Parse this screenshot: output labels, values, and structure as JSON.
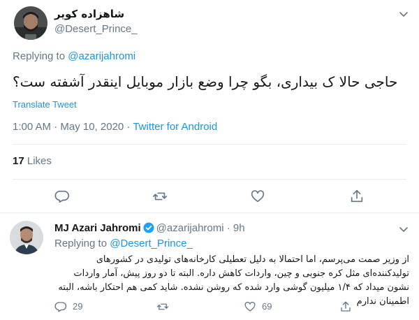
{
  "tweet": {
    "author_name": "شاهزاده کویر",
    "author_handle": "@Desert_Prince_",
    "replying_prefix": "Replying to ",
    "replying_to": "@azarijahromi",
    "text": "حاجی حالا ک بیداری، بگو چرا وضع بازار موبایل اینقدر آشفته ست؟",
    "translate_label": "Translate Tweet",
    "timestamp": "1:00 AM · May 10, 2020 · ",
    "source": "Twitter for Android",
    "likes_count": "17",
    "likes_label": " Likes",
    "icons": [
      "reply-icon",
      "retweet-icon",
      "like-icon",
      "share-icon",
      "chevron-down-icon"
    ]
  },
  "reply": {
    "author_name": "MJ Azari Jahromi",
    "author_handle": "@azarijahromi",
    "time": " · 9h",
    "replying_prefix": "Replying to ",
    "replying_to": "@Desert_Prince_",
    "text": "از وزیر صمت می‌پرسم، اما احتمالا به دلیل تعطیلی کارخانه‌های تولیدی در کشورهای تولیدکننده‌ای مثل کره جنوبی و چین، واردات کاهش داره. البته تا دو روز پیش، آمار واردات نشون میداد که ۱/۴ میلیون گوشی وارد شده که روشن نشده. شاید کمی هم احتکار باشه، البته اطمینان ندارم",
    "reply_count": "29",
    "like_count": "69",
    "icons": [
      "reply-icon",
      "retweet-icon",
      "like-icon",
      "share-icon",
      "verified-badge-icon"
    ]
  },
  "colors": {
    "link": "#1b95e0",
    "secondary_text": "#657786",
    "divider": "#e6ecf0",
    "verified": "#1da1f2"
  }
}
